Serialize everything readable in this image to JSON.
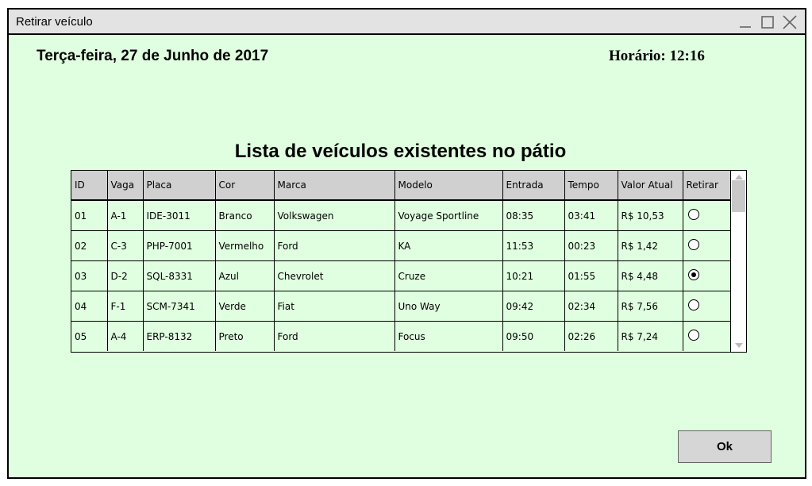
{
  "window": {
    "title": "Retirar veículo",
    "controls": {
      "minimize_icon": "minimize-icon",
      "maximize_icon": "maximize-icon",
      "close_icon": "close-icon"
    },
    "background_color": "#e0ffe0",
    "titlebar_color": "#e3e3e3"
  },
  "header": {
    "date": "Terça-feira, 27 de Junho de 2017",
    "time": "Horário: 12:16"
  },
  "list": {
    "title": "Lista de veículos existentes no pátio",
    "columns": [
      "ID",
      "Vaga",
      "Placa",
      "Cor",
      "Marca",
      "Modelo",
      "Entrada",
      "Tempo",
      "Valor Atual",
      "Retirar"
    ],
    "rows": [
      {
        "id": "01",
        "vaga": "A-1",
        "placa": "IDE-3011",
        "cor": "Branco",
        "marca": "Volkswagen",
        "modelo": "Voyage Sportline",
        "entrada": "08:35",
        "tempo": "03:41",
        "valor": "R$ 10,53",
        "retirar": false
      },
      {
        "id": "02",
        "vaga": "C-3",
        "placa": "PHP-7001",
        "cor": "Vermelho",
        "marca": "Ford",
        "modelo": "KA",
        "entrada": "11:53",
        "tempo": "00:23",
        "valor": "R$ 1,42",
        "retirar": false
      },
      {
        "id": "03",
        "vaga": "D-2",
        "placa": "SQL-8331",
        "cor": "Azul",
        "marca": "Chevrolet",
        "modelo": "Cruze",
        "entrada": "10:21",
        "tempo": "01:55",
        "valor": "R$ 4,48",
        "retirar": true
      },
      {
        "id": "04",
        "vaga": "F-1",
        "placa": "SCM-7341",
        "cor": "Verde",
        "marca": "Fiat",
        "modelo": "Uno Way",
        "entrada": "09:42",
        "tempo": "02:34",
        "valor": "R$ 7,56",
        "retirar": false
      },
      {
        "id": "05",
        "vaga": "A-4",
        "placa": "ERP-8132",
        "cor": "Preto",
        "marca": "Ford",
        "modelo": "Focus",
        "entrada": "09:50",
        "tempo": "02:26",
        "valor": "R$ 7,24",
        "retirar": false
      }
    ],
    "header_color": "#d0d0d0"
  },
  "actions": {
    "ok_label": "Ok"
  }
}
